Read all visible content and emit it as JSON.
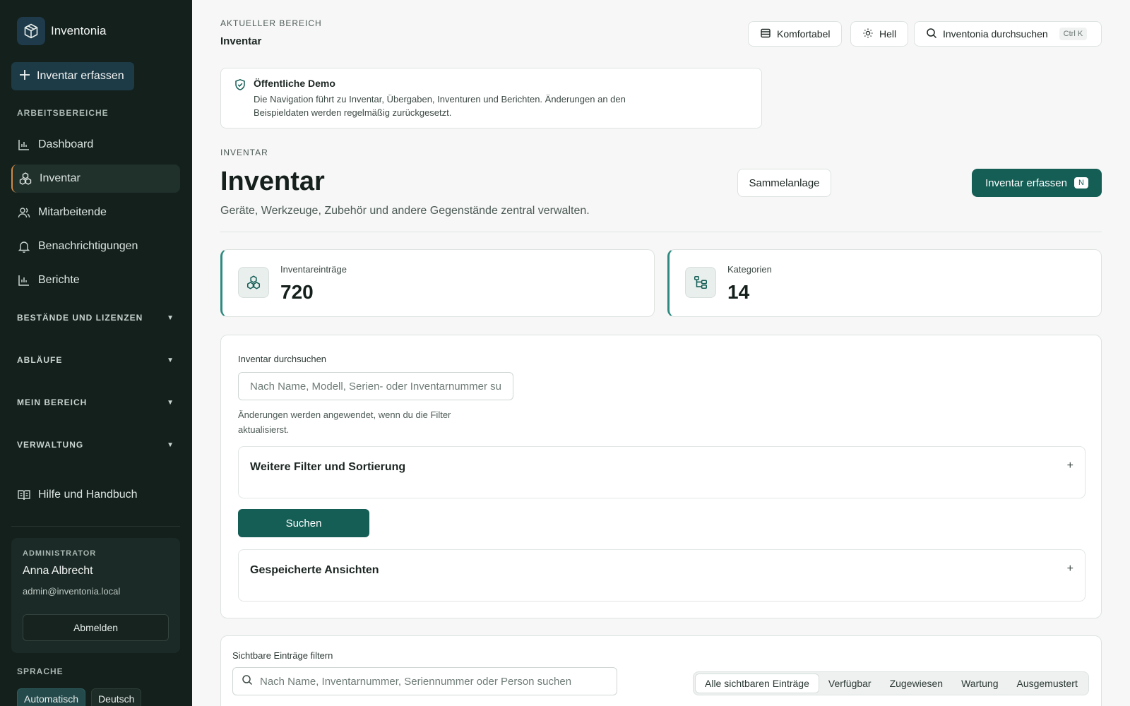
{
  "app": {
    "name": "Inventonia",
    "new_label": "Inventar erfassen"
  },
  "sidebar": {
    "heading": "ARBEITSBEREICHE",
    "items": [
      {
        "label": "Dashboard",
        "icon": "bar-chart-icon"
      },
      {
        "label": "Inventar",
        "icon": "boxes-icon",
        "active": true
      },
      {
        "label": "Mitarbeitende",
        "icon": "users-icon"
      },
      {
        "label": "Benachrichtigungen",
        "icon": "bell-icon"
      },
      {
        "label": "Berichte",
        "icon": "bar-chart-icon"
      }
    ],
    "sections": [
      "BESTÄNDE UND LIZENZEN",
      "ABLÄUFE",
      "MEIN BEREICH",
      "VERWALTUNG"
    ],
    "help_label": "Hilfe und Handbuch",
    "admin": {
      "role": "ADMINISTRATOR",
      "name": "Anna Albrecht",
      "email": "admin@inventonia.local",
      "logout_label": "Abmelden"
    },
    "language": {
      "heading": "SPRACHE",
      "options": [
        "Automatisch",
        "Deutsch"
      ],
      "selected": "Automatisch"
    }
  },
  "header": {
    "eyebrow": "AKTUELLER BEREICH",
    "title": "Inventar",
    "density_label": "Komfortabel",
    "theme_label": "Hell",
    "search_label": "Inventonia durchsuchen",
    "search_shortcut": "Ctrl K"
  },
  "notice": {
    "title": "Öffentliche Demo",
    "text": "Die Navigation führt zu Inventar, Übergaben, Inventuren und Berichten. Änderungen an den Beispieldaten werden regelmäßig zurückgesetzt."
  },
  "page": {
    "eyebrow": "INVENTAR",
    "title": "Inventar",
    "subtitle": "Geräte, Werkzeuge, Zubehör und andere Gegenstände zentral verwalten.",
    "bulk_label": "Sammelanlage",
    "primary_label": "Inventar erfassen",
    "primary_shortcut": "N"
  },
  "stats": [
    {
      "label": "Inventareinträge",
      "value": "720",
      "icon": "boxes-icon"
    },
    {
      "label": "Kategorien",
      "value": "14",
      "icon": "tree-icon"
    }
  ],
  "filters": {
    "search_label": "Inventar durchsuchen",
    "search_placeholder": "Nach Name, Modell, Serien- oder Inventarnummer su",
    "hint": "Änderungen werden angewendet, wenn du die Filter aktualisierst.",
    "more_label": "Weitere Filter und Sortierung",
    "search_button": "Suchen",
    "saved_label": "Gespeicherte Ansichten"
  },
  "visible": {
    "label": "Sichtbare Einträge filtern",
    "placeholder": "Nach Name, Inventarnummer, Seriennummer oder Person suchen",
    "tabs": [
      "Alle sichtbaren Einträge",
      "Verfügbar",
      "Zugewiesen",
      "Wartung",
      "Ausgemustert"
    ],
    "selected": "Alle sichtbaren Einträge"
  },
  "colors": {
    "accent": "#155e56",
    "sidebar_bg": "#13201c",
    "active_marker": "#d08a4a"
  }
}
